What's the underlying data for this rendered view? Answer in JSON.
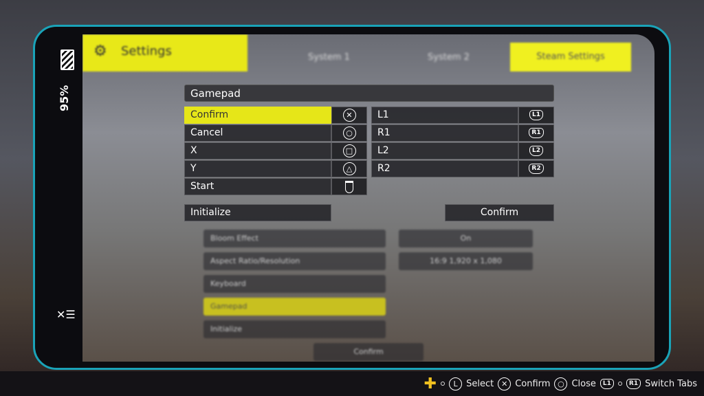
{
  "status": {
    "battery": "95%"
  },
  "tabs": {
    "settings": "Settings",
    "system1": "System 1",
    "system2": "System 2",
    "steam": "Steam Settings"
  },
  "background_items": [
    "Aspect Ratio/Resolution",
    "16:9 1,920 x 1,080",
    "Keyboard",
    "Gamepad",
    "Initialize",
    "Confirm",
    "Bloom Effect",
    "On"
  ],
  "panel": {
    "title": "Gamepad",
    "left": [
      {
        "label": "Confirm",
        "icon": "cross-button-icon",
        "glyph": "✕"
      },
      {
        "label": "Cancel",
        "icon": "circle-button-icon",
        "glyph": "○"
      },
      {
        "label": "X",
        "icon": "square-button-icon",
        "glyph": "□"
      },
      {
        "label": "Y",
        "icon": "triangle-button-icon",
        "glyph": "△"
      },
      {
        "label": "Start",
        "icon": "touchpad-icon",
        "glyph": ""
      }
    ],
    "right": [
      {
        "label": "L1",
        "badge": "L1"
      },
      {
        "label": "R1",
        "badge": "R1"
      },
      {
        "label": "L2",
        "badge": "L2"
      },
      {
        "label": "R2",
        "badge": "R2"
      }
    ],
    "initialize": "Initialize",
    "confirm": "Confirm"
  },
  "footer": {
    "select": "Select",
    "stick": "L",
    "confirm": "Confirm",
    "close": "Close",
    "l1": "L1",
    "r1": "R1",
    "switch": "Switch Tabs"
  },
  "colors": {
    "accent": "#e6e618",
    "frame": "#1aa3b8"
  }
}
